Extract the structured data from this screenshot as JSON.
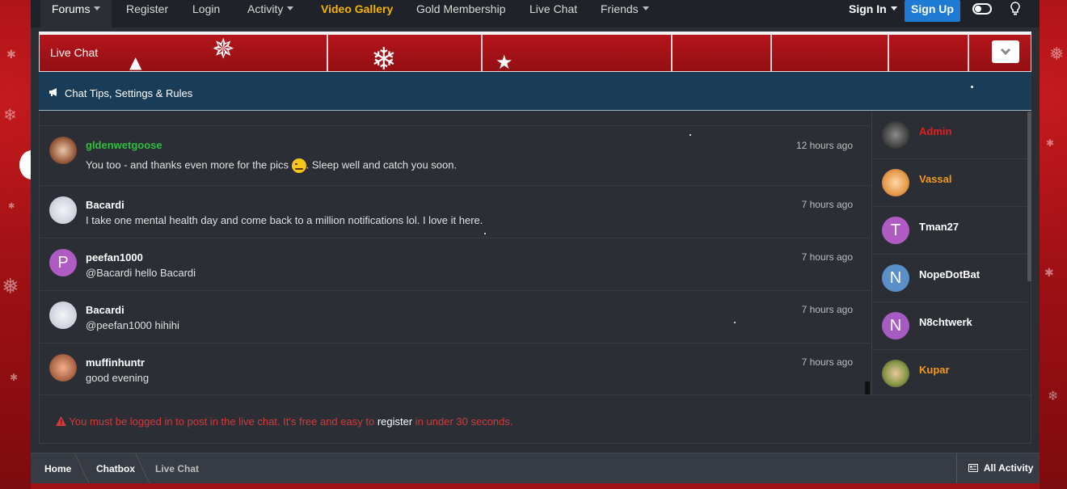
{
  "nav": {
    "forums": "Forums",
    "register": "Register",
    "login": "Login",
    "activity": "Activity",
    "video_gallery": "Video Gallery",
    "gold_membership": "Gold Membership",
    "live_chat": "Live Chat",
    "friends": "Friends",
    "sign_in": "Sign In",
    "sign_up": "Sign Up"
  },
  "chat": {
    "title": "Live Chat",
    "tips": "Chat Tips, Settings & Rules",
    "messages": [
      {
        "user": "gldenwetgoose",
        "user_color": "#2fbf3f",
        "text_before": "You too - and thanks even more for the pics",
        "text_after": ". Sleep well and catch you soon.",
        "time": "12 hours ago",
        "avatar": "photo"
      },
      {
        "user": "Bacardi",
        "user_color": "#ffffff",
        "text": "I take one mental health day and come back to a million notifications lol. I love it here.",
        "time": "7 hours ago",
        "avatar": "photo"
      },
      {
        "user": "peefan1000",
        "user_color": "#ffffff",
        "text": "@Bacardi hello Bacardi",
        "time": "7 hours ago",
        "avatar": "P",
        "avatar_color": "#b05bc4"
      },
      {
        "user": "Bacardi",
        "user_color": "#ffffff",
        "text": "@peefan1000 hihihi",
        "time": "7 hours ago",
        "avatar": "photo"
      },
      {
        "user": "muffinhuntr",
        "user_color": "#ffffff",
        "text": "good evening",
        "time": "7 hours ago",
        "avatar": "photo"
      }
    ],
    "users": [
      {
        "name": "Admin",
        "color": "#e02020",
        "avatar": "photo"
      },
      {
        "name": "Vassal",
        "color": "#f29a1b",
        "avatar": "photo"
      },
      {
        "name": "Tman27",
        "color": "#ffffff",
        "avatar": "T",
        "avatar_color": "#b05bc4"
      },
      {
        "name": "NopeDotBat",
        "color": "#ffffff",
        "avatar": "N",
        "avatar_color": "#5b8fc7"
      },
      {
        "name": "N8chtwerk",
        "color": "#ffffff",
        "avatar": "N",
        "avatar_color": "#a65bc2"
      },
      {
        "name": "Kupar",
        "color": "#f29a1b",
        "avatar": "photo"
      }
    ],
    "notice_before": "You must be logged in to post in the live chat. It's free and easy to",
    "notice_link": "register",
    "notice_after": "in under 30 seconds."
  },
  "breadcrumb": {
    "home": "Home",
    "chatbox": "Chatbox",
    "current": "Live Chat",
    "all_activity": "All Activity"
  },
  "icons": [
    "chevron-down-icon",
    "toggle-icon",
    "bulb-icon",
    "megaphone-icon",
    "warning-icon",
    "activity-icon"
  ]
}
